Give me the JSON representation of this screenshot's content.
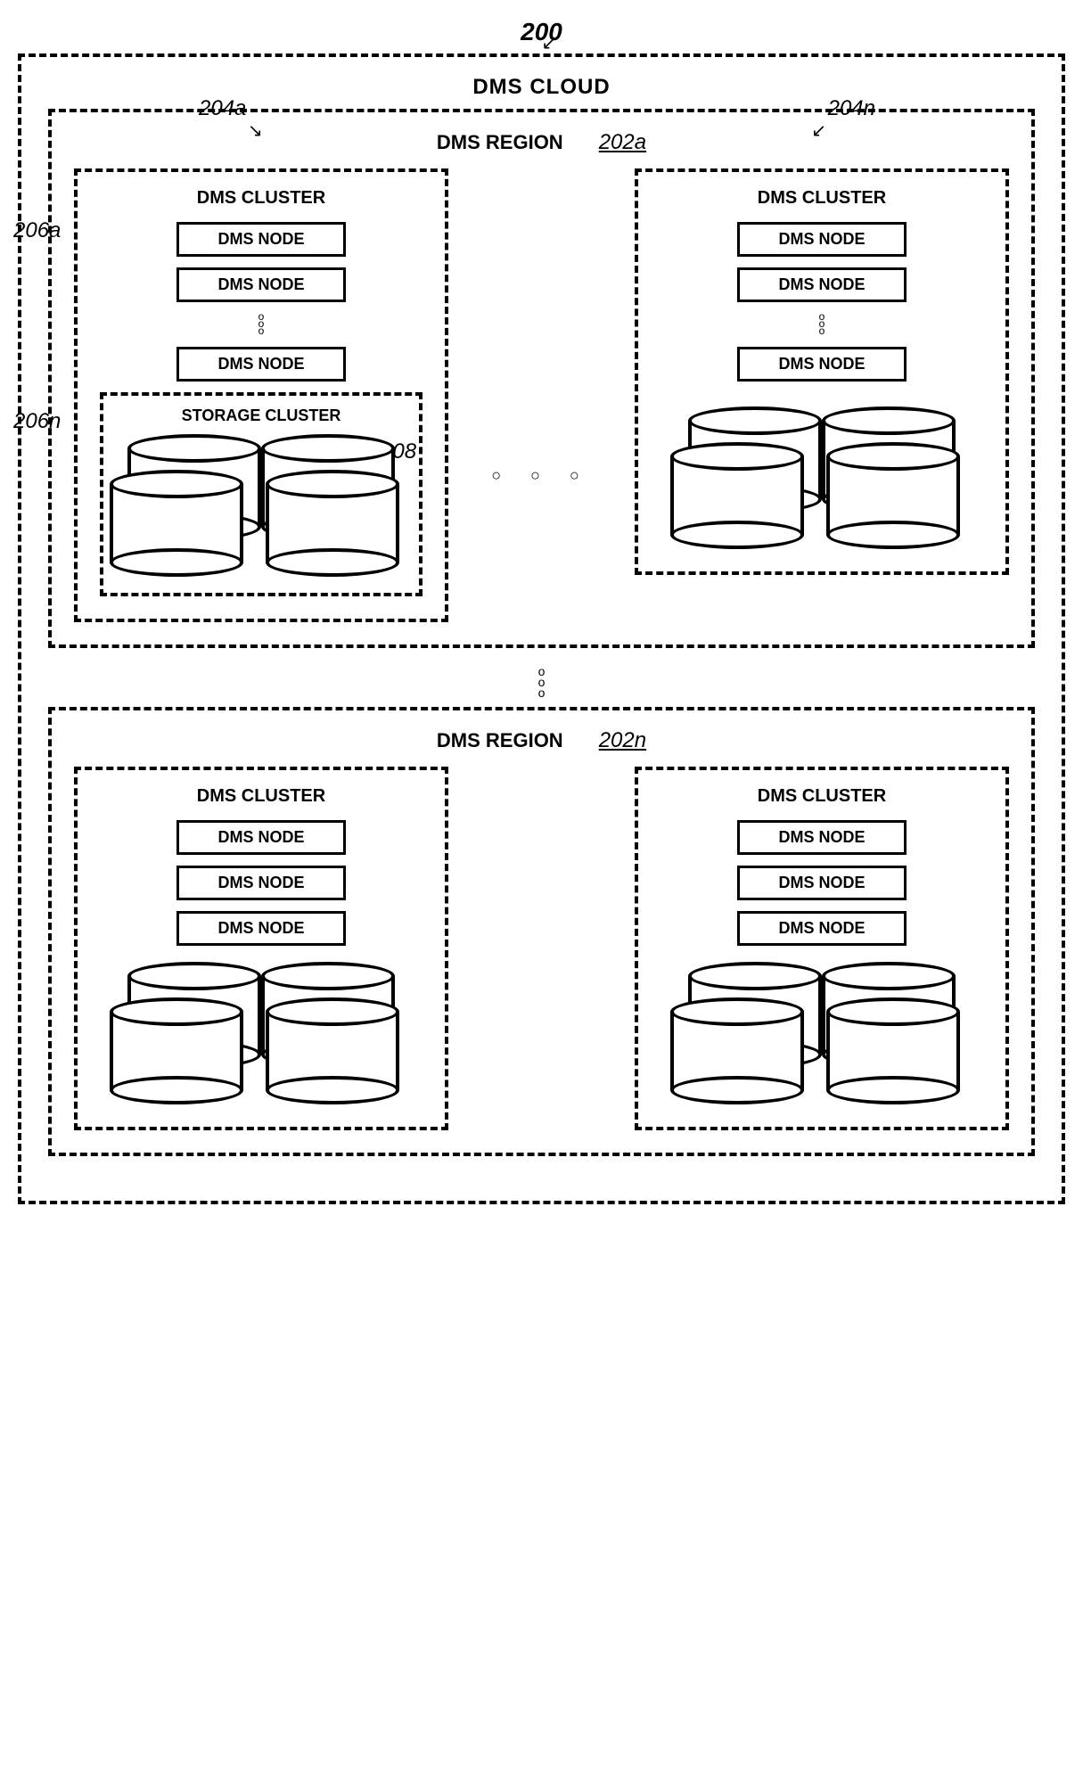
{
  "refs": {
    "r200": "200",
    "r204a": "204a",
    "r204n": "204n",
    "r206a": "206a",
    "r206n": "206n",
    "r208": "208",
    "r202a": "202a",
    "r202n": "202n"
  },
  "labels": {
    "cloud": "DMS CLOUD",
    "region": "DMS REGION",
    "cluster": "DMS CLUSTER",
    "node": "DMS NODE",
    "storage": "STORAGE CLUSTER"
  }
}
